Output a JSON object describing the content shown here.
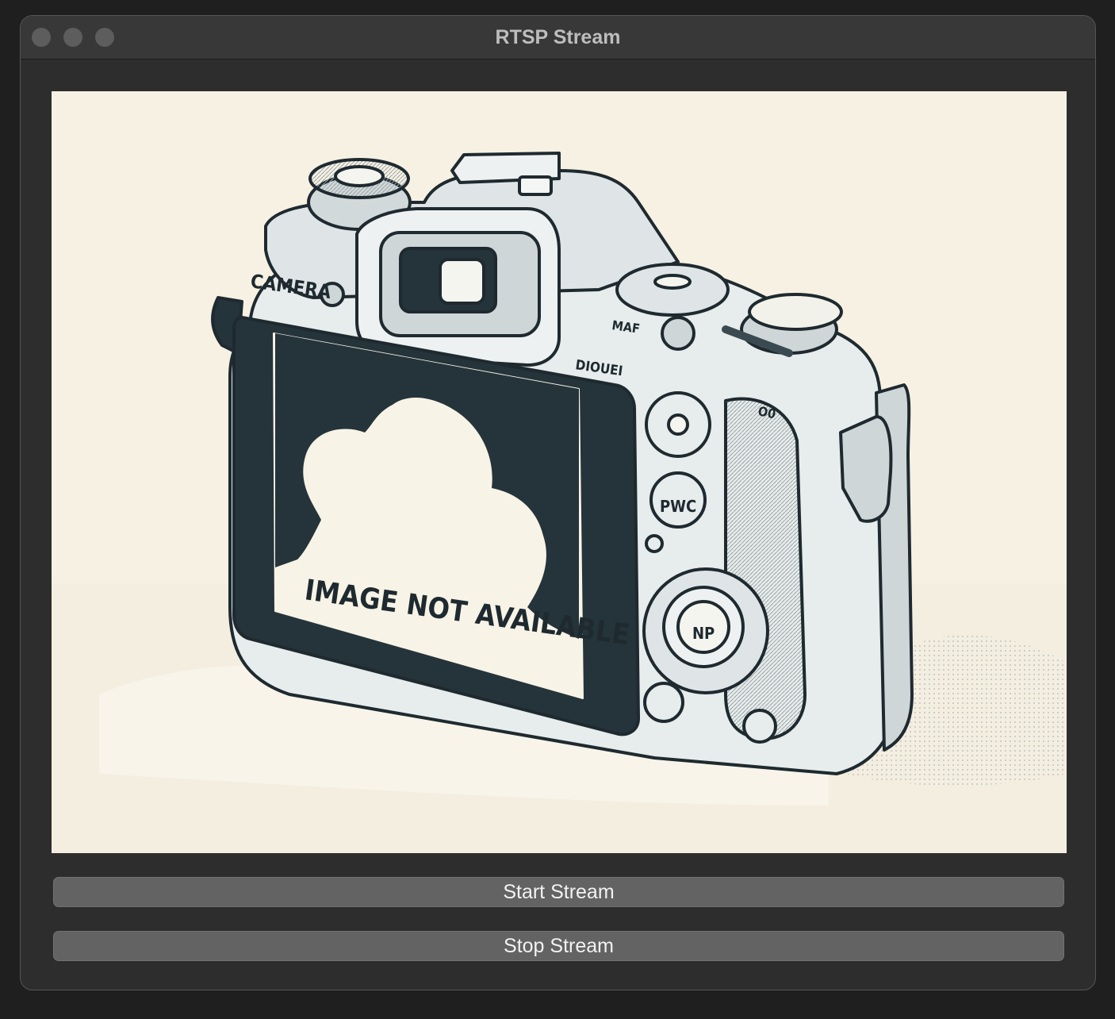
{
  "window": {
    "title": "RTSP Stream"
  },
  "preview": {
    "icon": "camera-illustration",
    "camera_brand": "CAMERA",
    "screen_text": "IMAGE NOT AVAILABLE",
    "mode_label": "DIOUEI",
    "button_label_pwc": "PWC",
    "button_label_np": "NP",
    "dial_label": "MAF",
    "grip_label": "O0"
  },
  "controls": {
    "start_label": "Start Stream",
    "stop_label": "Stop Stream"
  },
  "colors": {
    "window_bg": "#2d2d2d",
    "titlebar_bg": "#383838",
    "button_bg": "#636363",
    "preview_bg": "#f7f3e8",
    "ink": "#1e2a2f"
  }
}
